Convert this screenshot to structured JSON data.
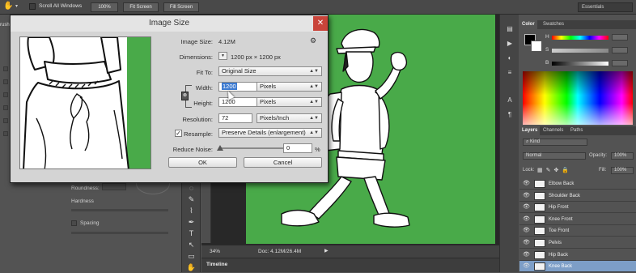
{
  "optionsbar": {
    "scroll_all_label": "Scroll All Windows",
    "zoom_100": "100%",
    "fit_screen": "Fit Screen",
    "fill_screen": "Fill Screen",
    "workspace": "Essentials"
  },
  "brushpanel": {
    "roundness": "Roundness:",
    "hardness": "Hardness",
    "spacing": "Spacing",
    "brush_tab": "rush"
  },
  "status": {
    "zoom": "34%",
    "doc": "Doc: 4.12M/26.4M",
    "timeline": "Timeline"
  },
  "color_panel": {
    "tabs": [
      "Color",
      "Swatches"
    ],
    "channels": [
      "H",
      "S",
      "B"
    ]
  },
  "layers_panel": {
    "tabs": [
      "Layers",
      "Channels",
      "Paths"
    ],
    "kind": "Kind",
    "blend_mode": "Normal",
    "opacity_label": "Opacity:",
    "opacity_value": "100%",
    "lock_label": "Lock:",
    "fill_label": "Fill:",
    "fill_value": "100%",
    "layers": [
      "Elbow Back",
      "Shoulder Back",
      "Hip Front",
      "Knee Front",
      "Toe Front",
      "Pelvis",
      "Hip Back",
      "Knee Back"
    ],
    "selected_layer": "Knee Back"
  },
  "dialog": {
    "title": "Image Size",
    "image_size_label": "Image Size:",
    "image_size_value": "4.12M",
    "dimensions_label": "Dimensions:",
    "dimensions_value": "1200 px  ×  1200 px",
    "fit_to_label": "Fit To:",
    "fit_to_value": "Original Size",
    "width_label": "Width:",
    "width_value": "1200",
    "width_unit": "Pixels",
    "height_label": "Height:",
    "height_value": "1200",
    "height_unit": "Pixels",
    "resolution_label": "Resolution:",
    "resolution_value": "72",
    "resolution_unit": "Pixels/Inch",
    "resample_label": "Resample:",
    "resample_value": "Preserve Details (enlargement)",
    "noise_label": "Reduce Noise:",
    "noise_value": "0",
    "noise_unit": "%",
    "ok": "OK",
    "cancel": "Cancel",
    "close": "✕"
  },
  "colors": {
    "canvas_green": "#49aa49",
    "selected_layer": "#7d9ec7",
    "close_red": "#c9443a"
  }
}
